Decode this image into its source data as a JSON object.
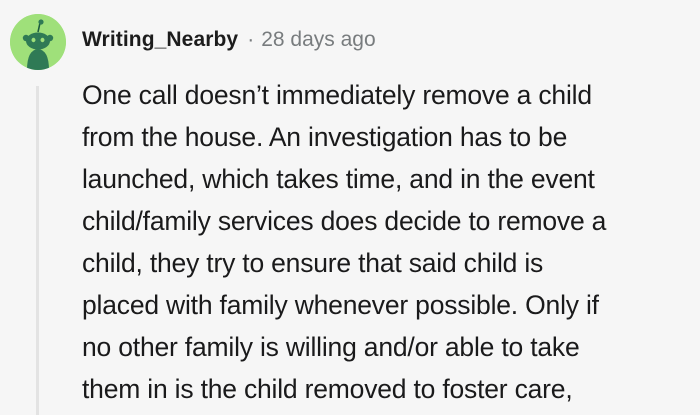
{
  "comment": {
    "author": "Writing_Nearby",
    "separator": "·",
    "timestamp": "28 days ago",
    "avatar_icon": "reddit-snoo-avatar-icon",
    "avatar_color": "#9fe07a",
    "body_lines": [
      "One call doesn’t immediately remove a child",
      "from the house. An investigation has to be",
      "launched, which takes time, and in the event",
      "child/family services does decide to remove a",
      "child, they try to ensure that said child is",
      "placed with family whenever possible. Only if",
      "no other family is willing and/or able to take",
      "them in is the child removed to foster care,"
    ]
  }
}
